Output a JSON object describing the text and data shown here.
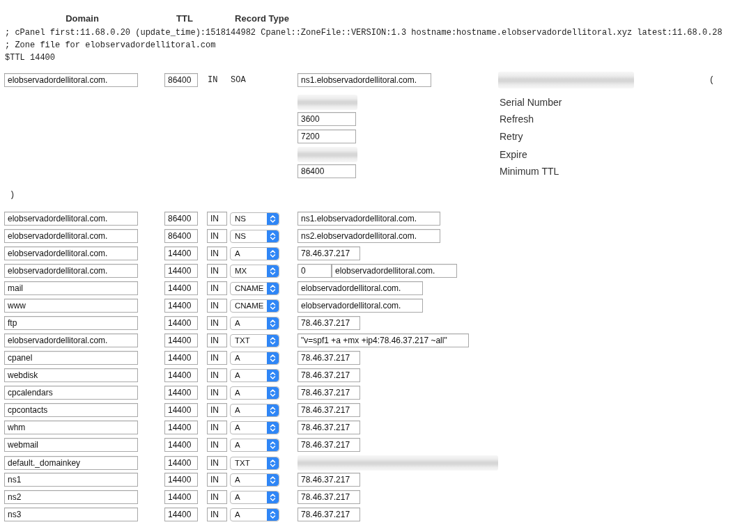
{
  "column_headers": [
    "Domain",
    "TTL",
    "Record Type"
  ],
  "zone_header_lines": [
    "; cPanel first:11.68.0.20 (update_time):1518144982 Cpanel::ZoneFile::VERSION:1.3 hostname:hostname.elobservadordellitoral.xyz latest:11.68.0.28",
    "; Zone file for elobservadordellitoral.com",
    "$TTL 14400"
  ],
  "soa_record": {
    "name": "elobservadordellitoral.com.",
    "ttl": "86400",
    "class": "IN",
    "type": "SOA",
    "primary_ns": "ns1.elobservadordellitoral.com.",
    "contact": {
      "redacted": true
    },
    "open_paren": "(",
    "fields": [
      {
        "label": "Serial Number",
        "redacted": true
      },
      {
        "label": "Refresh",
        "value": "3600"
      },
      {
        "label": "Retry",
        "value": "7200"
      },
      {
        "label": "Expire",
        "redacted": true
      },
      {
        "label": "Minimum TTL",
        "value": "86400"
      }
    ],
    "close_paren": ")"
  },
  "records": [
    {
      "name": "elobservadordellitoral.com.",
      "ttl": "86400",
      "class": "IN",
      "type": "NS",
      "data": "ns1.elobservadordellitoral.com."
    },
    {
      "name": "elobservadordellitoral.com.",
      "ttl": "86400",
      "class": "IN",
      "type": "NS",
      "data": "ns2.elobservadordellitoral.com."
    },
    {
      "name": "elobservadordellitoral.com.",
      "ttl": "14400",
      "class": "IN",
      "type": "A",
      "data": "78.46.37.217"
    },
    {
      "name": "elobservadordellitoral.com.",
      "ttl": "14400",
      "class": "IN",
      "type": "MX",
      "priority": "0",
      "data": "elobservadordellitoral.com."
    },
    {
      "name": "mail",
      "ttl": "14400",
      "class": "IN",
      "type": "CNAME",
      "data": "elobservadordellitoral.com."
    },
    {
      "name": "www",
      "ttl": "14400",
      "class": "IN",
      "type": "CNAME",
      "data": "elobservadordellitoral.com."
    },
    {
      "name": "ftp",
      "ttl": "14400",
      "class": "IN",
      "type": "A",
      "data": "78.46.37.217"
    },
    {
      "name": "elobservadordellitoral.com.",
      "ttl": "14400",
      "class": "IN",
      "type": "TXT",
      "data": "\"v=spf1 +a +mx +ip4:78.46.37.217 ~all\""
    },
    {
      "name": "cpanel",
      "ttl": "14400",
      "class": "IN",
      "type": "A",
      "data": "78.46.37.217"
    },
    {
      "name": "webdisk",
      "ttl": "14400",
      "class": "IN",
      "type": "A",
      "data": "78.46.37.217"
    },
    {
      "name": "cpcalendars",
      "ttl": "14400",
      "class": "IN",
      "type": "A",
      "data": "78.46.37.217"
    },
    {
      "name": "cpcontacts",
      "ttl": "14400",
      "class": "IN",
      "type": "A",
      "data": "78.46.37.217"
    },
    {
      "name": "whm",
      "ttl": "14400",
      "class": "IN",
      "type": "A",
      "data": "78.46.37.217"
    },
    {
      "name": "webmail",
      "ttl": "14400",
      "class": "IN",
      "type": "A",
      "data": "78.46.37.217"
    },
    {
      "name": "default._domainkey",
      "ttl": "14400",
      "class": "IN",
      "type": "TXT",
      "redacted": true
    },
    {
      "name": "ns1",
      "ttl": "14400",
      "class": "IN",
      "type": "A",
      "data": "78.46.37.217"
    },
    {
      "name": "ns2",
      "ttl": "14400",
      "class": "IN",
      "type": "A",
      "data": "78.46.37.217"
    },
    {
      "name": "ns3",
      "ttl": "14400",
      "class": "IN",
      "type": "A",
      "data": "78.46.37.217"
    }
  ]
}
